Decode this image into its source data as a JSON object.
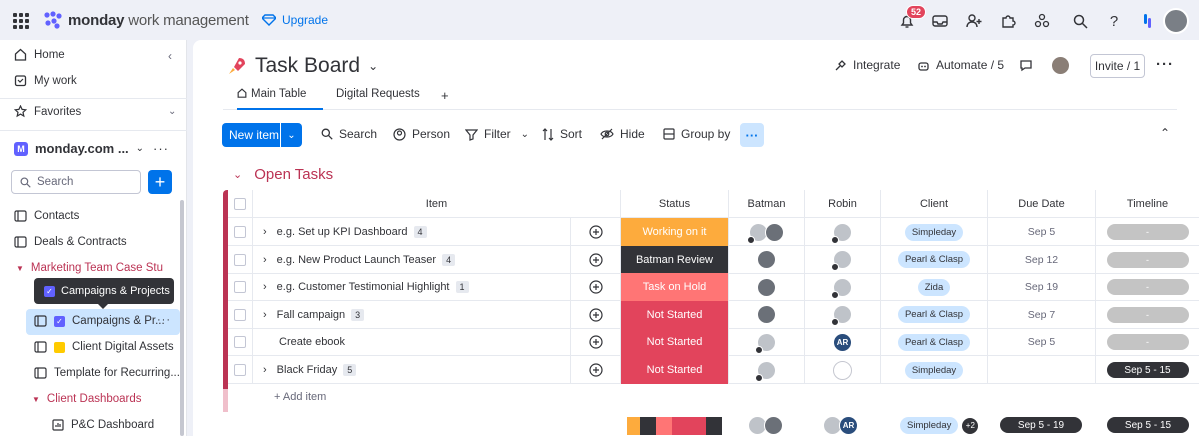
{
  "app": {
    "brand_bold": "monday",
    "brand_rest": " work management",
    "upgrade_label": "Upgrade",
    "notifications_count": "52",
    "accent_color": "#0073ea",
    "brand_color": "#6161ff"
  },
  "sidebar": {
    "home": "Home",
    "my_work": "My work",
    "favorites": "Favorites",
    "workspace_initial": "M",
    "workspace_name": "monday.com ...",
    "search_placeholder": "Search",
    "tooltip": "Campaigns & Projects",
    "items": [
      {
        "label": "Contacts",
        "icon": "board-icon"
      },
      {
        "label": "Deals & Contracts",
        "icon": "board-icon"
      },
      {
        "label": "Marketing Team Case Stu",
        "icon": "caret-down-icon"
      },
      {
        "label": "Campaigns & Pr...",
        "icon": "board-icon"
      },
      {
        "label": "Client Digital Assets",
        "icon": "board-icon"
      },
      {
        "label": "Template for Recurring...",
        "icon": "board-icon"
      },
      {
        "label": "Client Dashboards",
        "icon": "caret-down-icon"
      },
      {
        "label": "P&C Dashboard",
        "icon": "dashboard-icon"
      }
    ]
  },
  "header": {
    "title": "Task Board",
    "integrate": "Integrate",
    "automate": "Automate / 5",
    "invite": "Invite / 1"
  },
  "tabs": [
    {
      "label": "Main Table"
    },
    {
      "label": "Digital Requests"
    },
    {
      "label": "+"
    }
  ],
  "toolbar": {
    "new_item": "New item",
    "search": "Search",
    "person": "Person",
    "filter": "Filter",
    "sort": "Sort",
    "hide": "Hide",
    "group_by": "Group by",
    "more": "···"
  },
  "group": {
    "title": "Open Tasks",
    "color": "#bb3354",
    "add_item": "+ Add item"
  },
  "columns": [
    "Item",
    "Status",
    "Batman",
    "Robin",
    "Client",
    "Due Date",
    "Timeline"
  ],
  "rows": [
    {
      "item": "e.g. Set up KPI Dashboard",
      "count": "4",
      "status": "Working on it",
      "status_color": "#fdab3d",
      "client": "Simpleday",
      "due": "Sep 5",
      "timeline": "-",
      "timeline_dark": false,
      "robin": "photo"
    },
    {
      "item": "e.g. New Product Launch Teaser",
      "count": "4",
      "status": "Batman Review",
      "status_color": "#323338",
      "client": "Pearl & Clasp",
      "due": "Sep 12",
      "timeline": "-",
      "timeline_dark": false,
      "robin": "photo"
    },
    {
      "item": "e.g. Customer Testimonial Highlight",
      "count": "1",
      "status": "Task on Hold",
      "status_color": "#ff7575",
      "client": "Zida",
      "due": "Sep 19",
      "timeline": "-",
      "timeline_dark": false,
      "robin": "photo"
    },
    {
      "item": "Fall campaign",
      "count": "3",
      "status": "Not Started",
      "status_color": "#e2445c",
      "client": "Pearl & Clasp",
      "due": "Sep 7",
      "timeline": "-",
      "timeline_dark": false,
      "robin": "photo"
    },
    {
      "item": "Create ebook",
      "count": "",
      "status": "Not Started",
      "status_color": "#e2445c",
      "client": "Pearl & Clasp",
      "due": "Sep 5",
      "timeline": "-",
      "timeline_dark": false,
      "robin": "AR"
    },
    {
      "item": "Black Friday",
      "count": "5",
      "status": "Not Started",
      "status_color": "#e2445c",
      "client": "Simpleday",
      "due": "",
      "timeline": "Sep 5 - 15",
      "timeline_dark": true,
      "robin": "empty"
    }
  ],
  "summary": {
    "robin_initials": "AR",
    "client": "Simpleday",
    "client_more": "+2",
    "due": "Sep 5 - 19",
    "timeline": "Sep 5 - 15"
  }
}
